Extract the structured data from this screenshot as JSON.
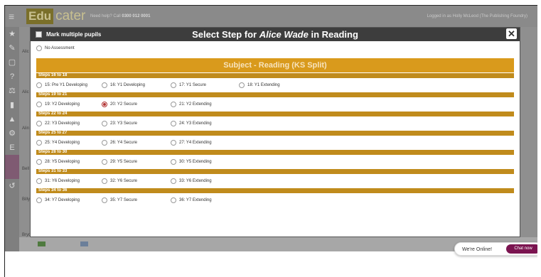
{
  "app": {
    "logo_a": "Edu",
    "logo_b": "cater",
    "help_prefix": "Need help? Call",
    "help_number": "0300 012 0001",
    "logged_in": "Logged in as Holly McLeod (The Publishing Foundry)",
    "pupils": [
      "Alic",
      "Alic",
      "Alin",
      "Bell",
      "Billy",
      "Bryd"
    ]
  },
  "modal": {
    "mark_multiple_label": "Mark multiple pupils",
    "title_prefix": "Select Step for",
    "pupil_name": "Alice Wade",
    "title_suffix": "in Reading",
    "close_label": "✕",
    "no_assessment_label": "No Assessment",
    "subject_label": "Subject - Reading (KS Split)",
    "groups": [
      {
        "heading": "Steps 16 to 18",
        "options": [
          "15: Pre Y1 Developing",
          "16: Y1 Developing",
          "17: Y1 Secure",
          "18: Y1 Extending"
        ]
      },
      {
        "heading": "Steps 19 to 21",
        "options": [
          "19: Y2 Developing",
          "20: Y2 Secure",
          "21: Y2 Extending"
        ]
      },
      {
        "heading": "Steps 22 to 24",
        "options": [
          "22: Y3 Developing",
          "23: Y3 Secure",
          "24: Y3 Extending"
        ]
      },
      {
        "heading": "Steps 25 to 27",
        "options": [
          "25: Y4 Developing",
          "26: Y4 Secure",
          "27: Y4 Extending"
        ]
      },
      {
        "heading": "Steps 28 to 30",
        "options": [
          "28: Y5 Developing",
          "29: Y5 Secure",
          "30: Y5 Extending"
        ]
      },
      {
        "heading": "Steps 31 to 33",
        "options": [
          "31: Y6 Developing",
          "32: Y6 Secure",
          "33: Y6 Extending"
        ]
      },
      {
        "heading": "Steps 34 to 36",
        "options": [
          "34: Y7 Developing",
          "35: Y7 Secure",
          "36: Y7 Extending"
        ]
      }
    ],
    "selected_option": "20: Y2 Secure"
  },
  "chat": {
    "status": "We're Online!",
    "button": "Chat now"
  },
  "colors": {
    "subject_bar": "#d99a1c",
    "group_header": "#c08b1c",
    "chat_button": "#7b1450"
  }
}
